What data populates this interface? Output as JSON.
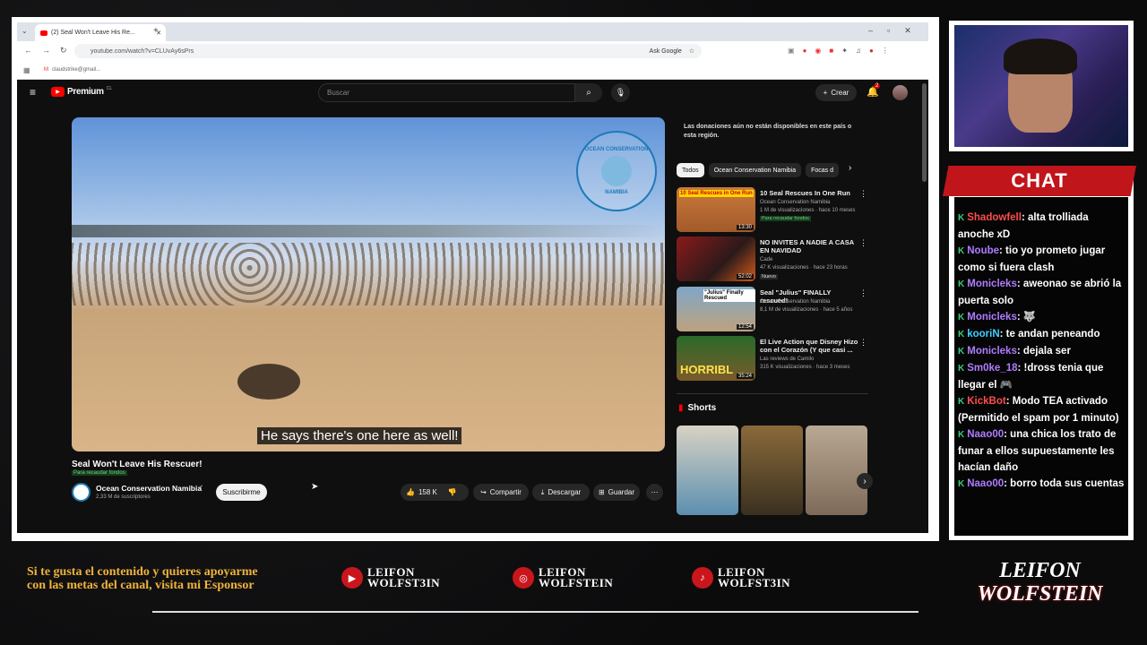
{
  "browser": {
    "tab_title": "(2) Seal Won't Leave His Re...",
    "url": "youtube.com/watch?v=CLUvAy6sPrs",
    "ask_google": "Ask Google",
    "bookmark_email": "claudstrike@gmail..."
  },
  "youtube": {
    "brand": "Premium",
    "brand_region": "CL",
    "search_placeholder": "Buscar",
    "create_label": "Crear",
    "notif_count": "2",
    "subtitle": "He says there's one here as well!",
    "video_title": "Seal Won't Leave His Rescuer!",
    "video_tag": "Para recaudar fondos",
    "channel_name": "Ocean Conservation Namibia",
    "channel_subs": "2,33 M de suscriptores",
    "subscribe_label": "Suscribirme",
    "like_count": "158 K",
    "share_label": "Compartir",
    "download_label": "Descargar",
    "save_label": "Guardar",
    "donation_notice": "Las donaciones aún no están disponibles en este país o esta región.",
    "logo_text_top": "OCEAN CONSERVATION",
    "logo_text_bottom": "NAMIBIA",
    "chips": [
      "Todos",
      "Ocean Conservation Namibia",
      "Focas d"
    ],
    "recommended": [
      {
        "title": "10 Seal Rescues In One Run",
        "channel": "Ocean Conservation Namibia",
        "meta": "1 M de visualizaciones · hace 10 meses",
        "tag": "Para recaudar fondos",
        "duration": "13:30",
        "thumb_text": "10 Seal Rescues in One Run"
      },
      {
        "title": "NO INVITES A NADIE A CASA EN NAVIDAD",
        "channel": "Cade",
        "meta": "47 K visualizaciones · hace 23 horas",
        "tag": "Nuevo",
        "duration": "52:02",
        "thumb_text": ""
      },
      {
        "title": "Seal \"Julius\" FINALLY rescued!",
        "channel": "Ocean Conservation Namibia",
        "meta": "8,1 M de visualizaciones · hace 5 años",
        "tag": "",
        "duration": "12:54",
        "thumb_text": "\"Julius\" Finally Rescued"
      },
      {
        "title": "El Live Action que Disney Hizo con el Corazón (Y que casi ...",
        "channel": "Las reviews de Camilo",
        "meta": "315 K visualizaciones · hace 3 meses",
        "tag": "",
        "duration": "35:24",
        "thumb_text": "HORRIBL"
      }
    ],
    "shorts_label": "Shorts"
  },
  "chat": {
    "title": "CHAT",
    "messages": [
      {
        "user": "Shadowfell",
        "color": "#ff4d4d",
        "text": ": alta trolliada anoche xD"
      },
      {
        "user": "Noube",
        "color": "#b07cff",
        "text": ": tio yo prometo jugar como si fuera clash"
      },
      {
        "user": "Monicleks",
        "color": "#b07cff",
        "text": ": aweonao se abrió la puerta solo"
      },
      {
        "user": "Monicleks",
        "color": "#b07cff",
        "text": ": 🐺"
      },
      {
        "user": "kooriN",
        "color": "#3fd0ff",
        "text": ": te andan peneando"
      },
      {
        "user": "Monicleks",
        "color": "#b07cff",
        "text": ": dejala ser"
      },
      {
        "user": "Sm0ke_18",
        "color": "#b07cff",
        "text": ": !dross tenia que llegar el 🎮"
      },
      {
        "user": "KickBot",
        "color": "#ff4d4d",
        "text": ": Modo TEA activado (Permitido el spam por 1 minuto)"
      },
      {
        "user": "Naao00",
        "color": "#b07cff",
        "text": ": una chica los trato de funar a ellos supuestamente les hacían daño"
      },
      {
        "user": "Naao00",
        "color": "#b07cff",
        "text": ": borro toda sus cuentas"
      }
    ]
  },
  "footer": {
    "sponsor_text": "Si te gusta el contenido y quieres apoyarme con las metas del canal, visita mi Esponsor",
    "socials": [
      {
        "icon": "youtube-icon",
        "line1": "LEIFON",
        "line2": "WOLFST3IN"
      },
      {
        "icon": "instagram-icon",
        "line1": "LEIFON",
        "line2": "WOLFSTEIN"
      },
      {
        "icon": "tiktok-icon",
        "line1": "LEIFON",
        "line2": "WOLFST3IN"
      }
    ],
    "logo_top": "LEIFON",
    "logo_bottom": "WOLFSTEIN"
  },
  "colors": {
    "accent": "#c0151a",
    "footer_gold": "#f0b33a",
    "chat_green": "#33d17a"
  }
}
